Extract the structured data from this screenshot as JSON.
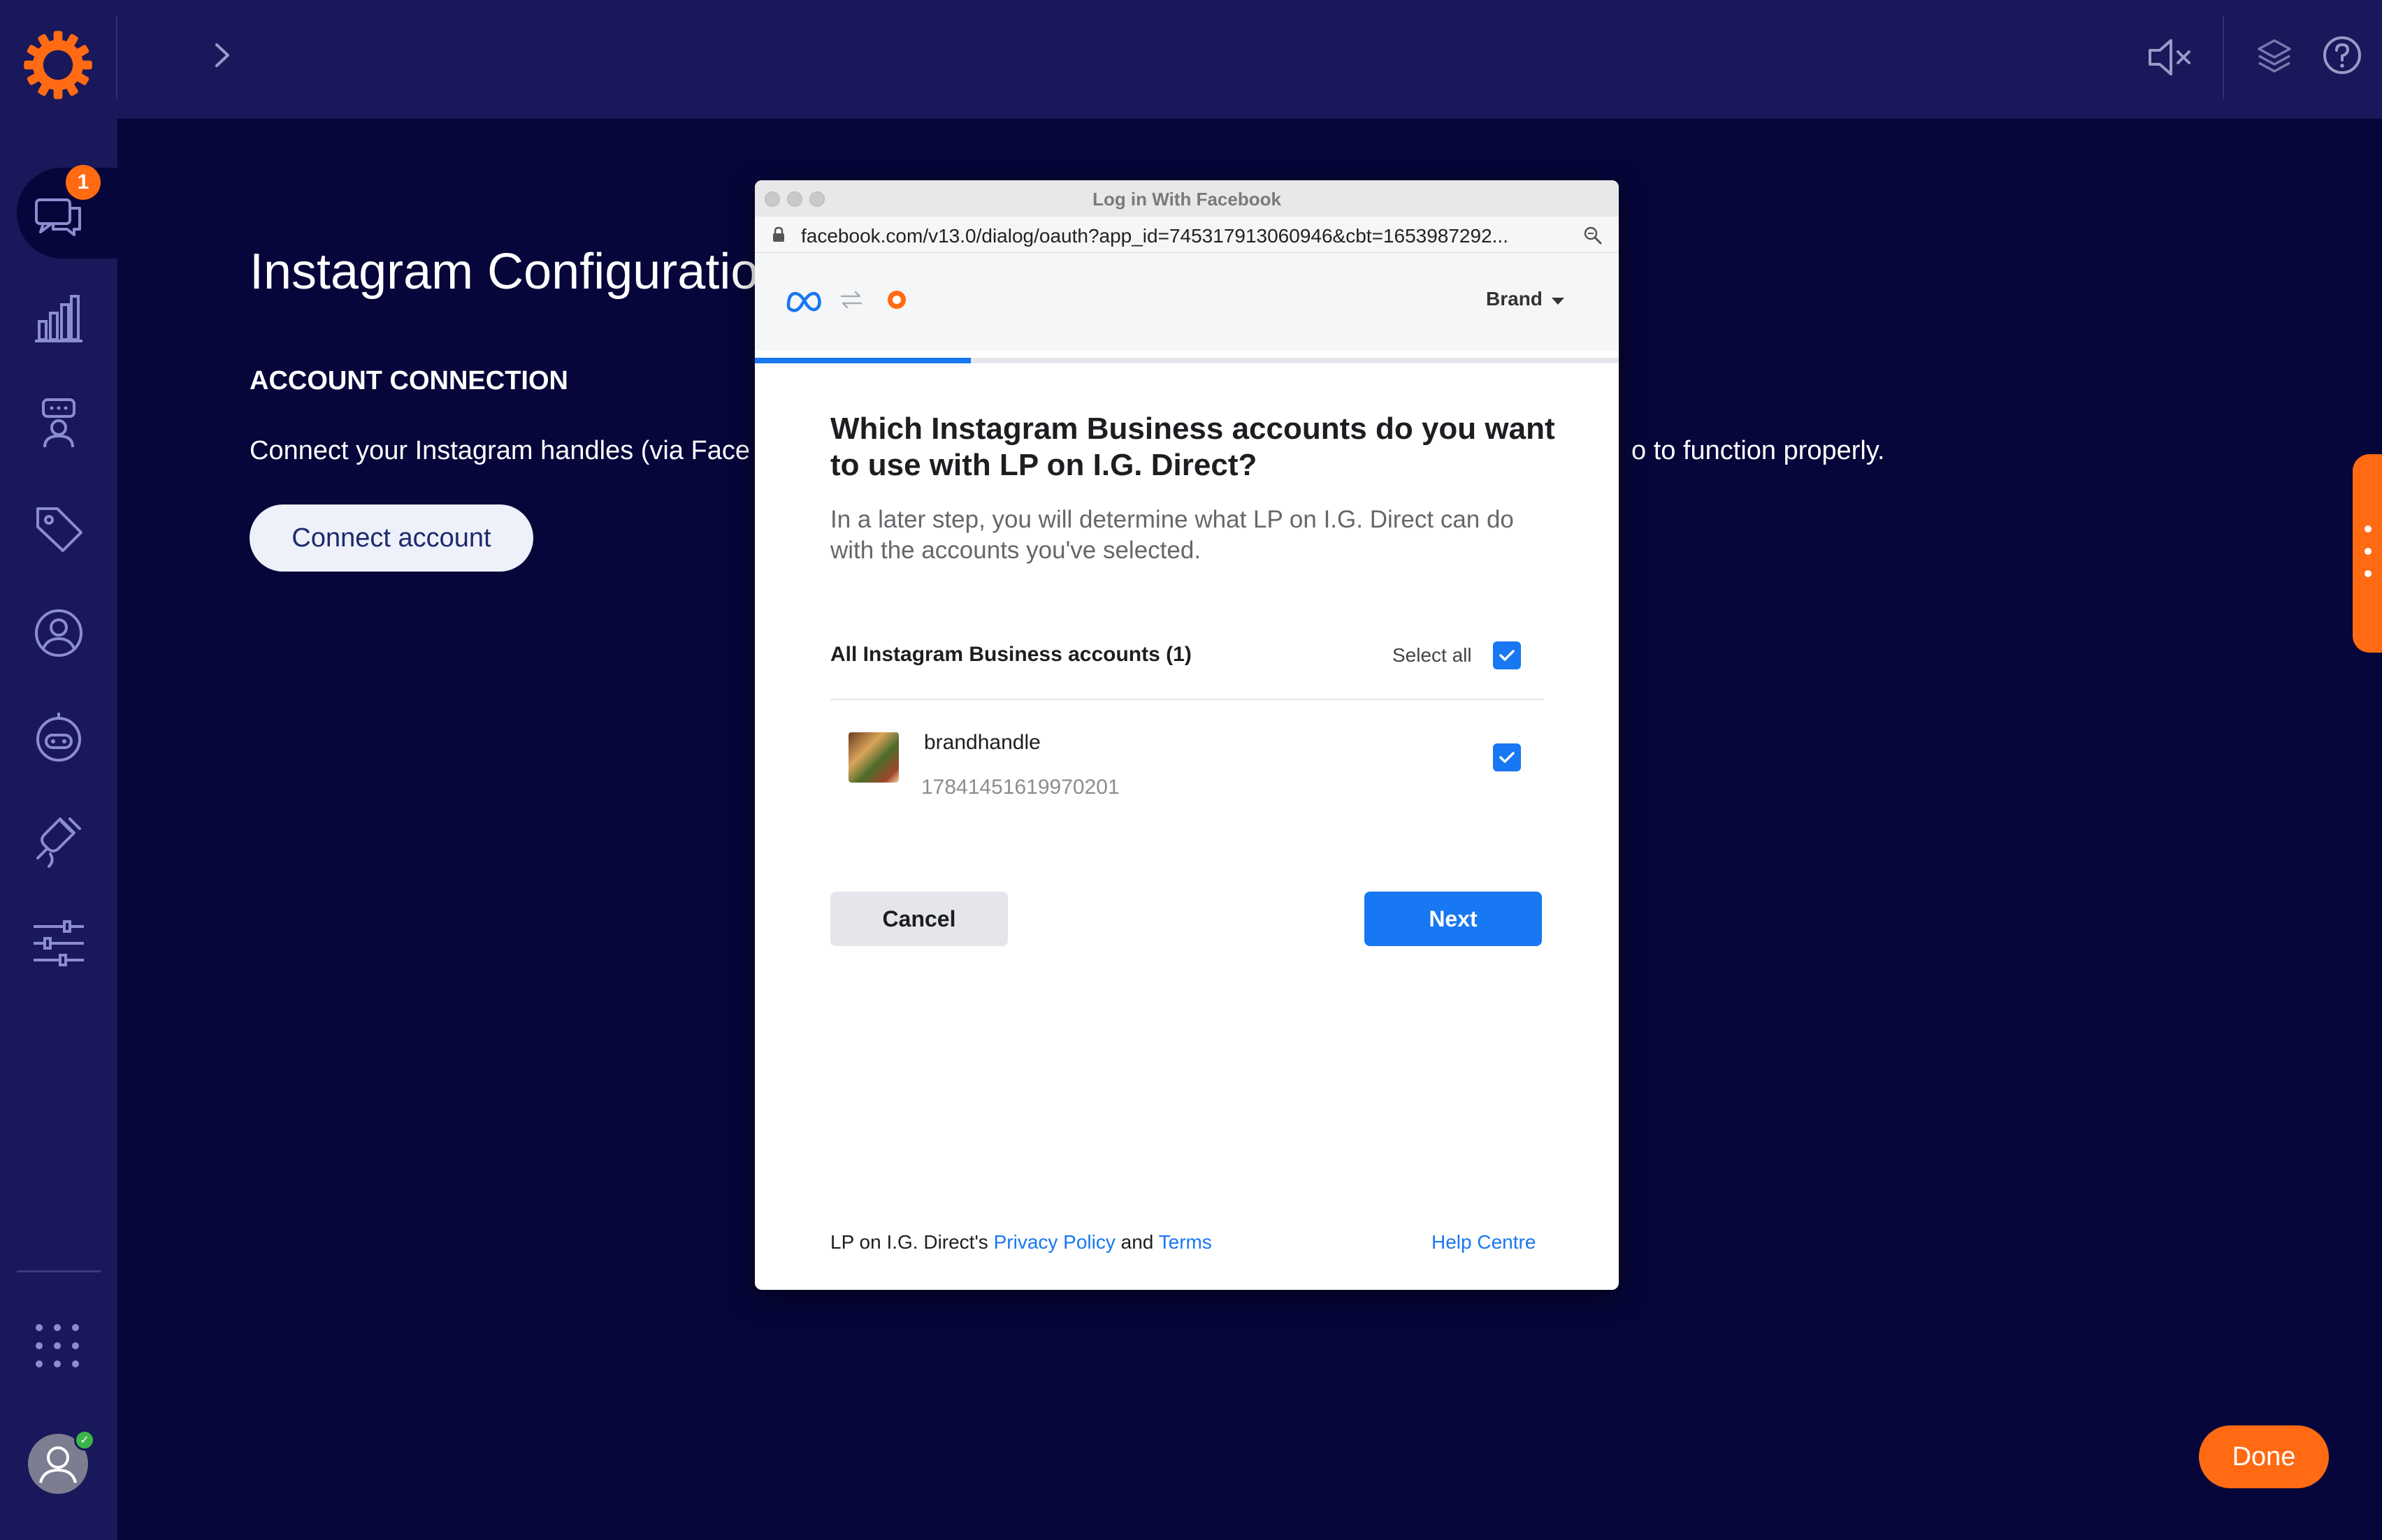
{
  "topbar": {
    "logo_icon": "sun-gear-logo",
    "expand_icon": "chevron-right-icon",
    "right_icons": [
      "speaker-muted-icon",
      "layers-icon",
      "help-circle-icon"
    ]
  },
  "sidebar": {
    "items": [
      {
        "icon": "chat-bubbles-icon",
        "badge": "1",
        "active": true
      },
      {
        "icon": "bar-chart-icon"
      },
      {
        "icon": "agent-icon"
      },
      {
        "icon": "tag-icon"
      },
      {
        "icon": "user-circle-icon"
      },
      {
        "icon": "bot-icon"
      },
      {
        "icon": "plug-icon"
      },
      {
        "icon": "sliders-icon"
      }
    ],
    "apps_icon": "apps-grid-icon",
    "avatar_status": "✓"
  },
  "main": {
    "title": "Instagram Configuratio",
    "section_heading": "ACCOUNT CONNECTION",
    "description_left": "Connect your Instagram handles (via Face",
    "description_right": "o to function properly.",
    "connect_button": "Connect account",
    "done_button": "Done"
  },
  "popup": {
    "window_title": "Log in With Facebook",
    "url": "facebook.com/v13.0/dialog/oauth?app_id=745317913060946&cbt=1653987292...",
    "brand_selector": "Brand",
    "progress_fraction": 0.25,
    "question": "Which Instagram Business accounts do you want to use with LP on I.G. Direct?",
    "subtext": "In a later step, you will determine what LP on I.G. Direct can do with the accounts you've selected.",
    "accounts_header": "All Instagram Business accounts (1)",
    "select_all_label": "Select all",
    "select_all_checked": true,
    "accounts": [
      {
        "name": "brandhandle",
        "id": "17841451619970201",
        "checked": true
      }
    ],
    "cancel_label": "Cancel",
    "next_label": "Next",
    "footer": {
      "prefix": "LP on I.G. Direct's ",
      "privacy_link": "Privacy Policy",
      "and_text": " and ",
      "terms_link": "Terms",
      "help_link": "Help Centre"
    }
  },
  "colors": {
    "background": "#06063a",
    "sidebar": "#18185a",
    "accent_orange": "#ff6a13",
    "facebook_blue": "#1877f2"
  }
}
